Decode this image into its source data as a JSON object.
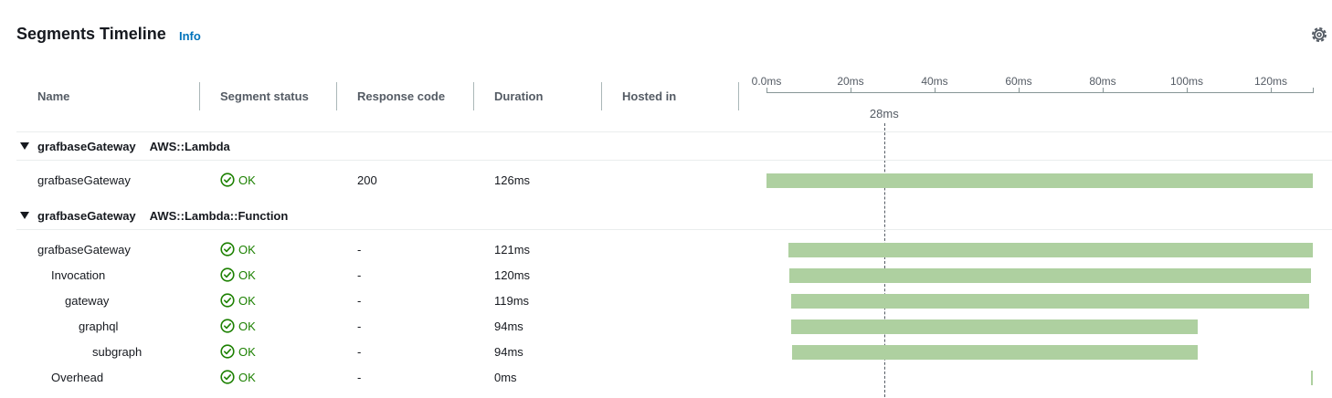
{
  "header": {
    "title": "Segments Timeline",
    "info_label": "Info"
  },
  "columns": {
    "name": "Name",
    "status": "Segment status",
    "response": "Response code",
    "duration": "Duration",
    "hosted": "Hosted in"
  },
  "axis": {
    "ticks": [
      "0.0ms",
      "20ms",
      "40ms",
      "60ms",
      "80ms",
      "100ms",
      "120ms"
    ],
    "marker": "28ms",
    "max_ms": 130
  },
  "colors": {
    "bar": "#aed0a0",
    "ok": "#1d8102",
    "link": "#0073bb"
  },
  "groups": [
    {
      "name": "grafbaseGateway",
      "type": "AWS::Lambda",
      "rows": [
        {
          "name": "grafbaseGateway",
          "depth": 0,
          "status": "OK",
          "response": "200",
          "duration": "126ms",
          "start_ms": 0.0,
          "end_ms": 130.0
        }
      ]
    },
    {
      "name": "grafbaseGateway",
      "type": "AWS::Lambda::Function",
      "rows": [
        {
          "name": "grafbaseGateway",
          "depth": 0,
          "status": "OK",
          "response": "-",
          "duration": "121ms",
          "start_ms": 5.2,
          "end_ms": 130.0
        },
        {
          "name": "Invocation",
          "depth": 1,
          "status": "OK",
          "response": "-",
          "duration": "120ms",
          "start_ms": 5.4,
          "end_ms": 129.6
        },
        {
          "name": "gateway",
          "depth": 2,
          "status": "OK",
          "response": "-",
          "duration": "119ms",
          "start_ms": 5.9,
          "end_ms": 129.1
        },
        {
          "name": "graphql",
          "depth": 3,
          "status": "OK",
          "response": "-",
          "duration": "94ms",
          "start_ms": 5.9,
          "end_ms": 102.6
        },
        {
          "name": "subgraph",
          "depth": 4,
          "status": "OK",
          "response": "-",
          "duration": "94ms",
          "start_ms": 6.1,
          "end_ms": 102.6
        },
        {
          "name": "Overhead",
          "depth": 1,
          "status": "OK",
          "response": "-",
          "duration": "0ms",
          "start_ms": 129.5,
          "end_ms": 129.8
        }
      ]
    }
  ]
}
